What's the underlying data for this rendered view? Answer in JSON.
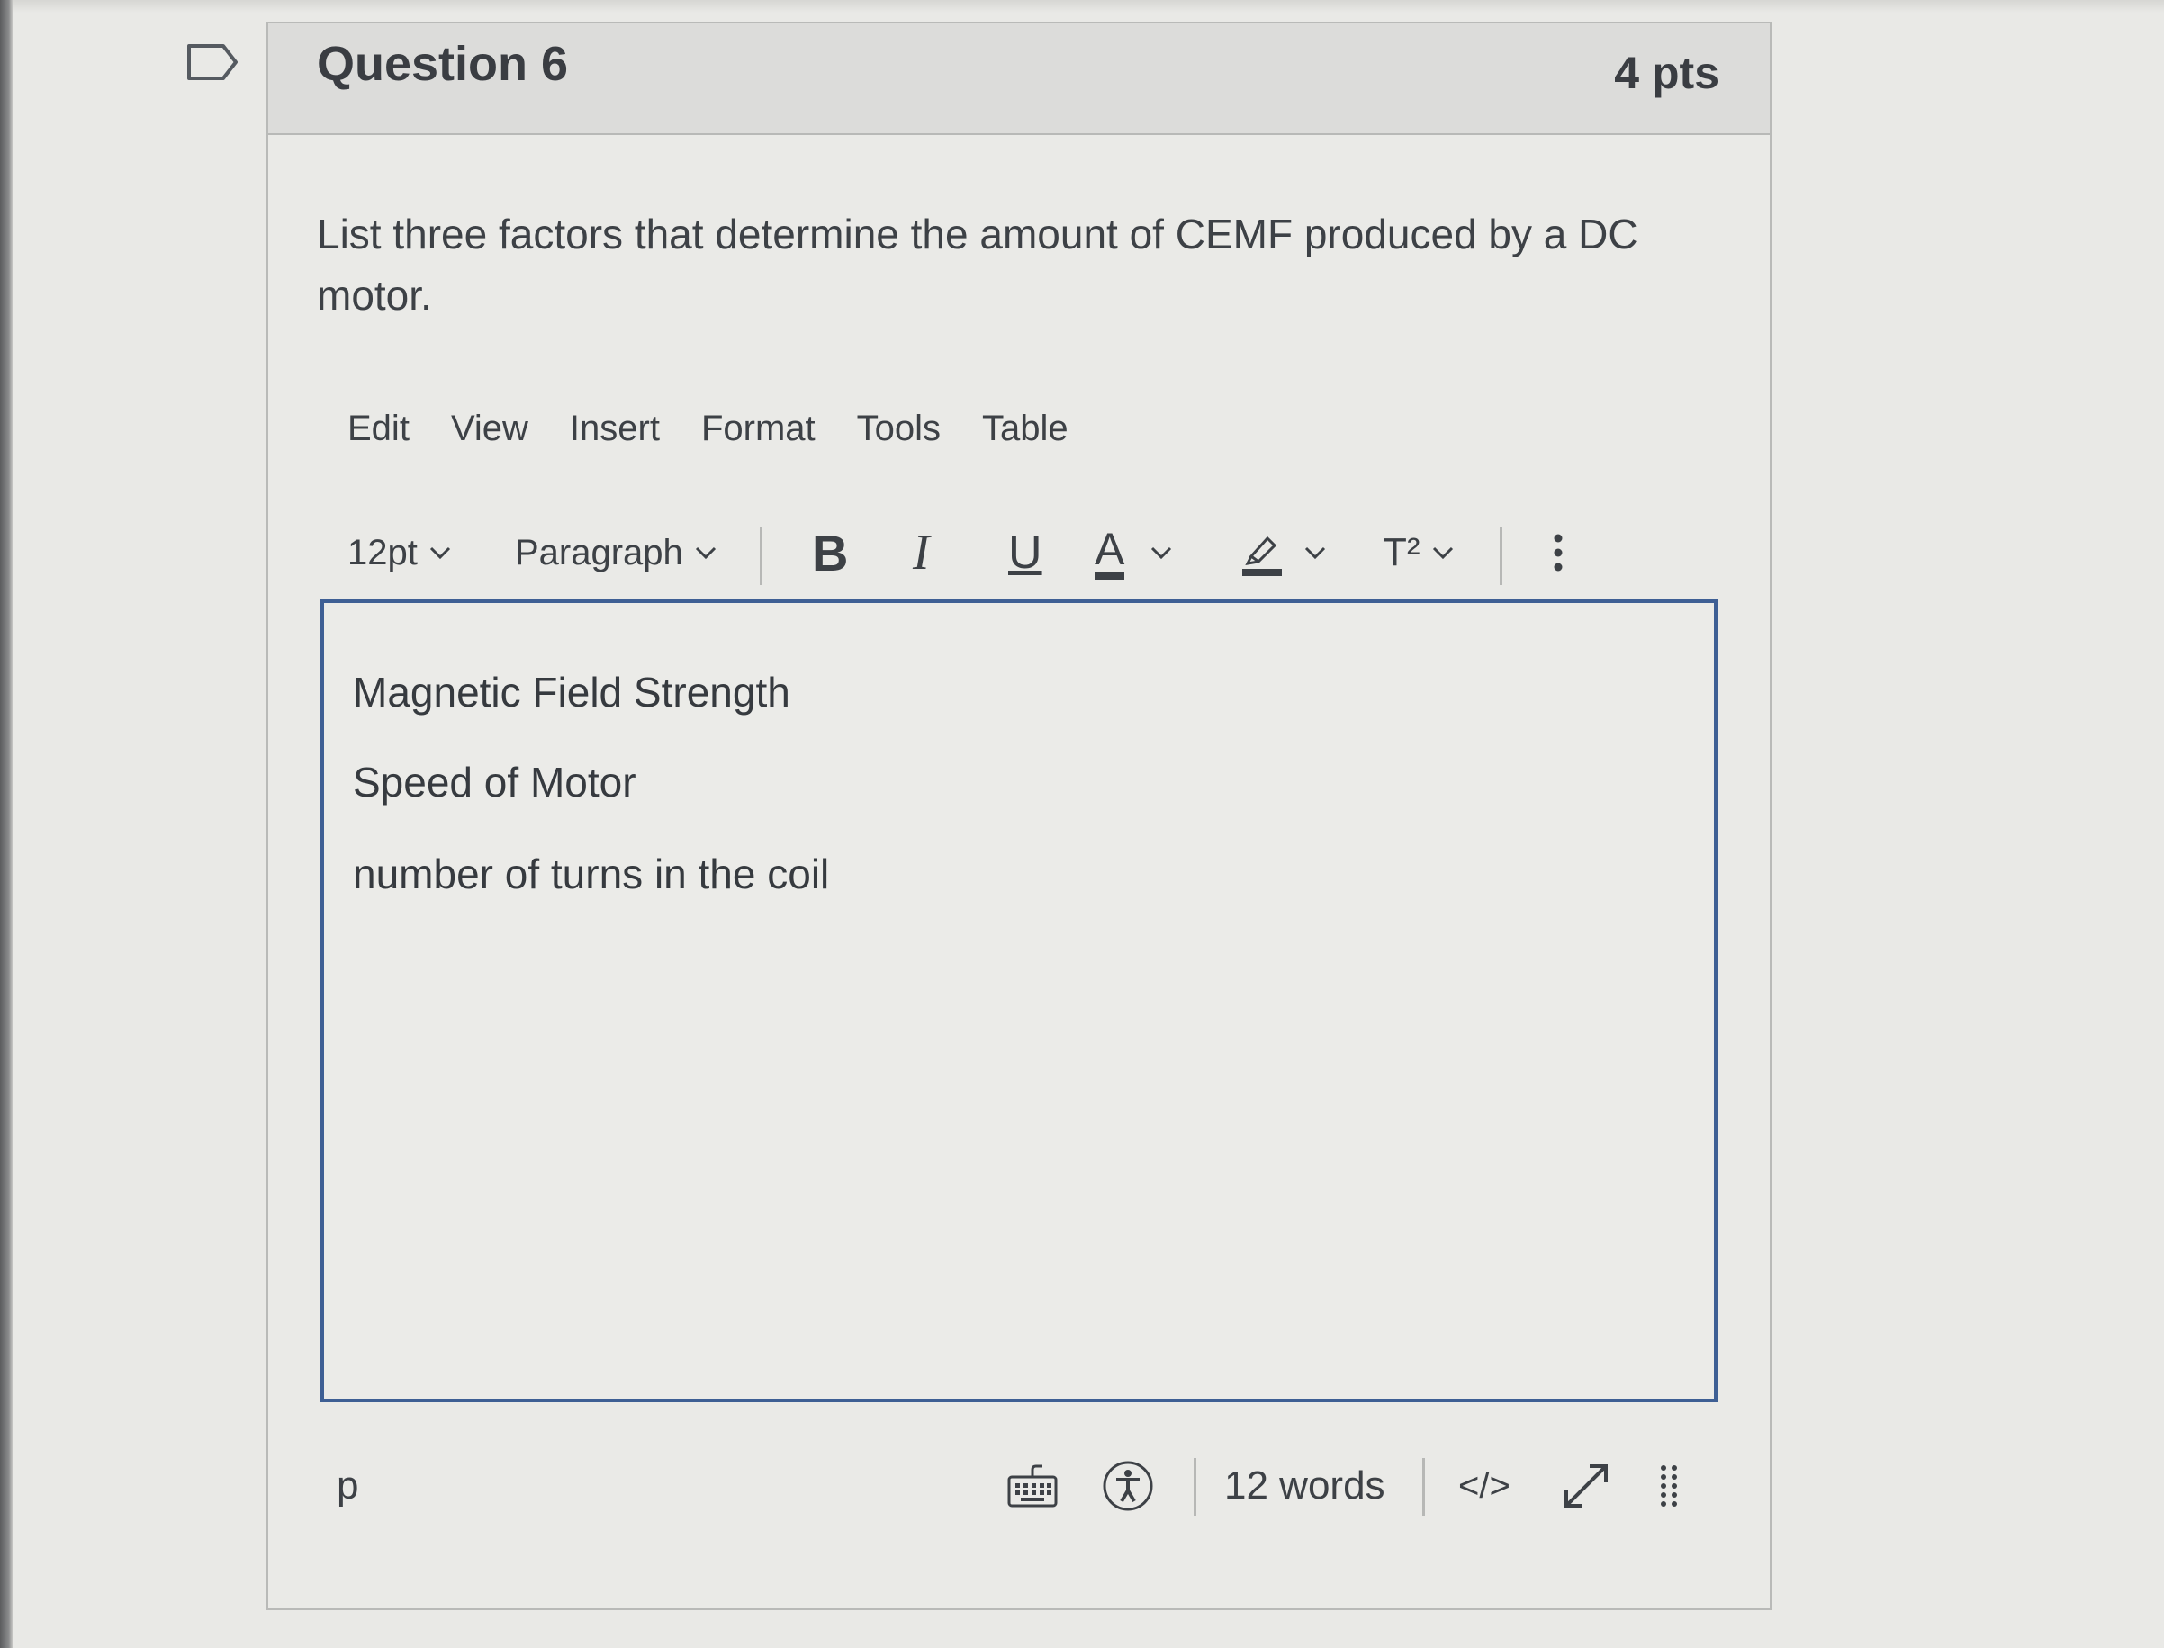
{
  "question": {
    "title": "Question 6",
    "points": "4 pts",
    "prompt": "List three factors that determine the amount of CEMF produced by a DC motor.",
    "flag_icon": "flag-outline-icon"
  },
  "editor": {
    "menu": [
      "Edit",
      "View",
      "Insert",
      "Format",
      "Tools",
      "Table"
    ],
    "toolbar": {
      "font_size": "12pt",
      "block_format": "Paragraph",
      "bold_label": "B",
      "italic_label": "I",
      "underline_label": "U",
      "text_color_label": "A",
      "superscript_label": "T²",
      "icons": [
        "chevron-down-icon",
        "highlighter-icon",
        "more-vertical-icon"
      ]
    },
    "content": [
      "Magnetic Field Strength",
      "Speed of Motor",
      "number of turns in the coil"
    ],
    "status": {
      "element_path": "p",
      "word_count": "12 words",
      "html_toggle": "</>",
      "icons": [
        "keyboard-icon",
        "accessibility-icon",
        "expand-icon",
        "resize-handle-icon"
      ]
    }
  },
  "colors": {
    "editor_border": "#3e5f94",
    "header_bg": "#dcdcda",
    "page_bg": "#e9e9e6",
    "text": "#3b3f44"
  }
}
